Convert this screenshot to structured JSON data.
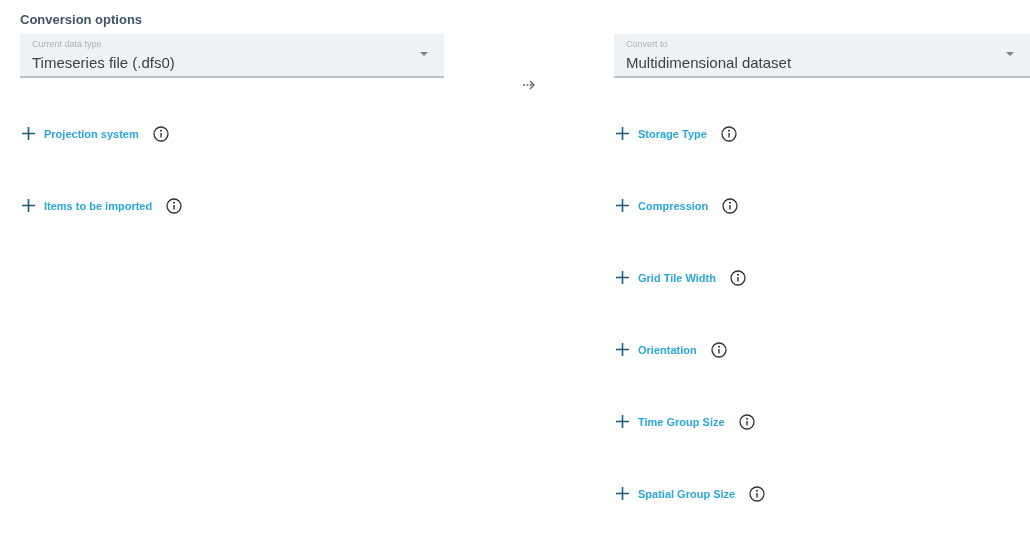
{
  "section_title": "Conversion options",
  "source": {
    "label": "Current data type",
    "value": "Timeseries file (.dfs0)"
  },
  "target": {
    "label": "Convert to",
    "value": "Multidimensional dataset"
  },
  "source_options": [
    {
      "label": "Projection system"
    },
    {
      "label": "Items to be imported"
    }
  ],
  "target_options": [
    {
      "label": "Storage Type"
    },
    {
      "label": "Compression"
    },
    {
      "label": "Grid Tile Width"
    },
    {
      "label": "Orientation"
    },
    {
      "label": "Time Group Size"
    },
    {
      "label": "Spatial Group Size"
    }
  ]
}
